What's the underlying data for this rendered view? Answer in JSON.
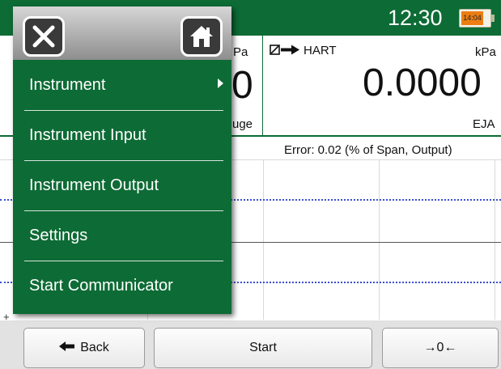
{
  "status_bar": {
    "clock": "12:30",
    "battery_label": "14:04"
  },
  "left_panel": {
    "unit_partial": "Pa",
    "value_partial": "0",
    "label_partial": "uge"
  },
  "hart_panel": {
    "mode": "HART",
    "unit": "kPa",
    "value": "0.0000",
    "device": "EJA"
  },
  "graph": {
    "error_label": "Error: 0.02 (% of Span, Output)",
    "corner_marker": "+"
  },
  "bottom_bar": {
    "back_label": "Back",
    "start_label": "Start",
    "zero_label": "→0←"
  },
  "menu": {
    "close_icon": "close-icon",
    "home_icon": "home-icon",
    "items": [
      {
        "label": "Instrument",
        "has_submenu": true
      },
      {
        "label": "Instrument Input"
      },
      {
        "label": "Instrument Output"
      },
      {
        "label": "Settings"
      },
      {
        "label": "Start Communicator"
      }
    ]
  },
  "colors": {
    "header_green": "#0d6b35",
    "plot_dots": "#3b4fcf",
    "battery": "#ec7d12"
  }
}
